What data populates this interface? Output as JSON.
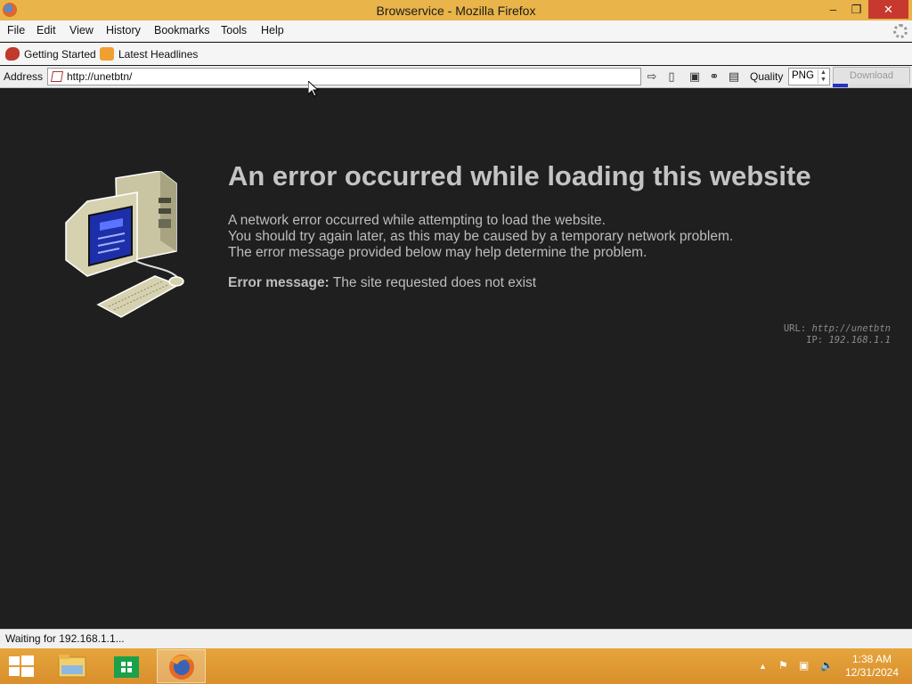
{
  "window": {
    "title": "Browservice - Mozilla Firefox",
    "controls": {
      "minimize": "–",
      "maximize": "❐",
      "close": "✕"
    }
  },
  "menu": {
    "items": [
      {
        "label": "File"
      },
      {
        "label": "Edit"
      },
      {
        "label": "View"
      },
      {
        "label": "History"
      },
      {
        "label": "Bookmarks"
      },
      {
        "label": "Tools"
      },
      {
        "label": "Help"
      }
    ]
  },
  "bookmarks": {
    "items": [
      {
        "label": "Getting Started",
        "icon": "firefox-bookmark-icon"
      },
      {
        "label": "Latest Headlines",
        "icon": "rss-icon"
      }
    ]
  },
  "address_bar": {
    "label": "Address",
    "url": "http://unetbtn/",
    "quality_label": "Quality",
    "quality_value": "PNG",
    "download_label": "Download",
    "progress_fraction": 0.2
  },
  "page": {
    "heading": "An error occurred while loading this website",
    "lines": [
      "A network error occurred while attempting to load the website.",
      "You should try again later, as this may be caused by a temporary network problem.",
      "The error message provided below may help determine the problem."
    ],
    "error_label": "Error message:",
    "error_text": "The site requested does not exist",
    "url_label": "URL:",
    "url_value": "http://unetbtn",
    "ip_label": "IP:",
    "ip_value": "192.168.1.1"
  },
  "status": {
    "text": "Waiting for 192.168.1.1..."
  },
  "taskbar": {
    "time": "1:38 AM",
    "date": "12/31/2024"
  },
  "colors": {
    "title_bar": "#e9b449",
    "content_bg": "#1f1f1f",
    "close_button": "#c7382f",
    "progress_fill": "#2432c8"
  }
}
